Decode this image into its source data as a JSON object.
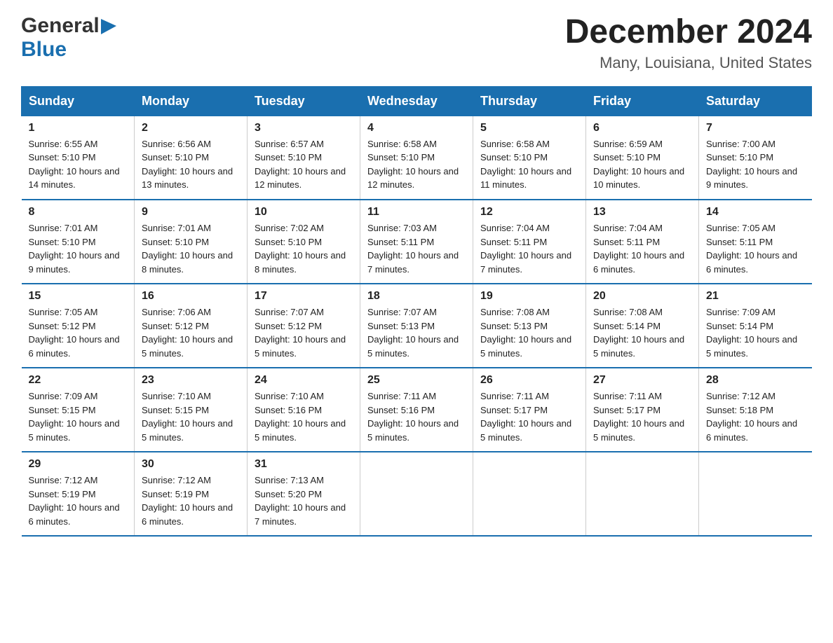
{
  "header": {
    "logo": {
      "general": "General",
      "blue": "Blue",
      "arrow": "▶"
    },
    "title": "December 2024",
    "location": "Many, Louisiana, United States"
  },
  "calendar": {
    "days_of_week": [
      "Sunday",
      "Monday",
      "Tuesday",
      "Wednesday",
      "Thursday",
      "Friday",
      "Saturday"
    ],
    "weeks": [
      [
        {
          "day": "1",
          "sunrise": "6:55 AM",
          "sunset": "5:10 PM",
          "daylight": "10 hours and 14 minutes."
        },
        {
          "day": "2",
          "sunrise": "6:56 AM",
          "sunset": "5:10 PM",
          "daylight": "10 hours and 13 minutes."
        },
        {
          "day": "3",
          "sunrise": "6:57 AM",
          "sunset": "5:10 PM",
          "daylight": "10 hours and 12 minutes."
        },
        {
          "day": "4",
          "sunrise": "6:58 AM",
          "sunset": "5:10 PM",
          "daylight": "10 hours and 12 minutes."
        },
        {
          "day": "5",
          "sunrise": "6:58 AM",
          "sunset": "5:10 PM",
          "daylight": "10 hours and 11 minutes."
        },
        {
          "day": "6",
          "sunrise": "6:59 AM",
          "sunset": "5:10 PM",
          "daylight": "10 hours and 10 minutes."
        },
        {
          "day": "7",
          "sunrise": "7:00 AM",
          "sunset": "5:10 PM",
          "daylight": "10 hours and 9 minutes."
        }
      ],
      [
        {
          "day": "8",
          "sunrise": "7:01 AM",
          "sunset": "5:10 PM",
          "daylight": "10 hours and 9 minutes."
        },
        {
          "day": "9",
          "sunrise": "7:01 AM",
          "sunset": "5:10 PM",
          "daylight": "10 hours and 8 minutes."
        },
        {
          "day": "10",
          "sunrise": "7:02 AM",
          "sunset": "5:10 PM",
          "daylight": "10 hours and 8 minutes."
        },
        {
          "day": "11",
          "sunrise": "7:03 AM",
          "sunset": "5:11 PM",
          "daylight": "10 hours and 7 minutes."
        },
        {
          "day": "12",
          "sunrise": "7:04 AM",
          "sunset": "5:11 PM",
          "daylight": "10 hours and 7 minutes."
        },
        {
          "day": "13",
          "sunrise": "7:04 AM",
          "sunset": "5:11 PM",
          "daylight": "10 hours and 6 minutes."
        },
        {
          "day": "14",
          "sunrise": "7:05 AM",
          "sunset": "5:11 PM",
          "daylight": "10 hours and 6 minutes."
        }
      ],
      [
        {
          "day": "15",
          "sunrise": "7:05 AM",
          "sunset": "5:12 PM",
          "daylight": "10 hours and 6 minutes."
        },
        {
          "day": "16",
          "sunrise": "7:06 AM",
          "sunset": "5:12 PM",
          "daylight": "10 hours and 5 minutes."
        },
        {
          "day": "17",
          "sunrise": "7:07 AM",
          "sunset": "5:12 PM",
          "daylight": "10 hours and 5 minutes."
        },
        {
          "day": "18",
          "sunrise": "7:07 AM",
          "sunset": "5:13 PM",
          "daylight": "10 hours and 5 minutes."
        },
        {
          "day": "19",
          "sunrise": "7:08 AM",
          "sunset": "5:13 PM",
          "daylight": "10 hours and 5 minutes."
        },
        {
          "day": "20",
          "sunrise": "7:08 AM",
          "sunset": "5:14 PM",
          "daylight": "10 hours and 5 minutes."
        },
        {
          "day": "21",
          "sunrise": "7:09 AM",
          "sunset": "5:14 PM",
          "daylight": "10 hours and 5 minutes."
        }
      ],
      [
        {
          "day": "22",
          "sunrise": "7:09 AM",
          "sunset": "5:15 PM",
          "daylight": "10 hours and 5 minutes."
        },
        {
          "day": "23",
          "sunrise": "7:10 AM",
          "sunset": "5:15 PM",
          "daylight": "10 hours and 5 minutes."
        },
        {
          "day": "24",
          "sunrise": "7:10 AM",
          "sunset": "5:16 PM",
          "daylight": "10 hours and 5 minutes."
        },
        {
          "day": "25",
          "sunrise": "7:11 AM",
          "sunset": "5:16 PM",
          "daylight": "10 hours and 5 minutes."
        },
        {
          "day": "26",
          "sunrise": "7:11 AM",
          "sunset": "5:17 PM",
          "daylight": "10 hours and 5 minutes."
        },
        {
          "day": "27",
          "sunrise": "7:11 AM",
          "sunset": "5:17 PM",
          "daylight": "10 hours and 5 minutes."
        },
        {
          "day": "28",
          "sunrise": "7:12 AM",
          "sunset": "5:18 PM",
          "daylight": "10 hours and 6 minutes."
        }
      ],
      [
        {
          "day": "29",
          "sunrise": "7:12 AM",
          "sunset": "5:19 PM",
          "daylight": "10 hours and 6 minutes."
        },
        {
          "day": "30",
          "sunrise": "7:12 AM",
          "sunset": "5:19 PM",
          "daylight": "10 hours and 6 minutes."
        },
        {
          "day": "31",
          "sunrise": "7:13 AM",
          "sunset": "5:20 PM",
          "daylight": "10 hours and 7 minutes."
        },
        null,
        null,
        null,
        null
      ]
    ]
  }
}
